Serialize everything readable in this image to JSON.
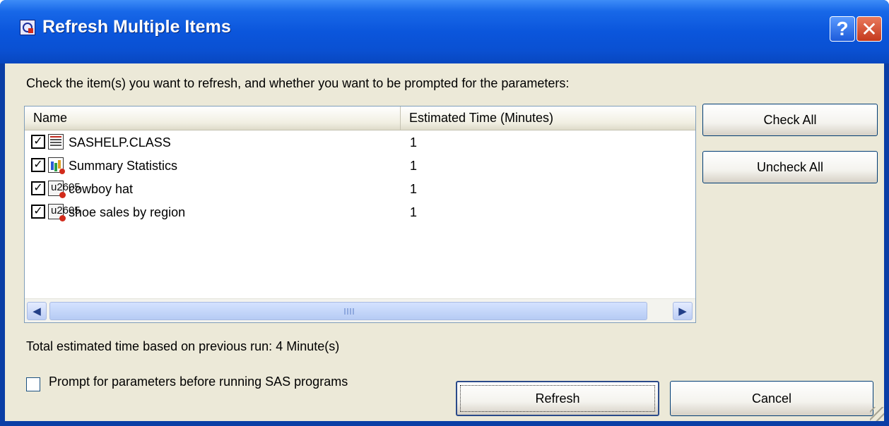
{
  "window": {
    "title": "Refresh Multiple Items",
    "help_label": "?",
    "close_label": "✕"
  },
  "instruction": "Check the item(s) you want to refresh, and whether you want to be prompted for the parameters:",
  "list": {
    "columns": [
      "Name",
      "Estimated Time (Minutes)"
    ],
    "items": [
      {
        "checked": true,
        "icon": "data-table-icon",
        "name": "SASHELP.CLASS",
        "time": "1"
      },
      {
        "checked": true,
        "icon": "statistics-task-icon",
        "name": "Summary Statistics",
        "time": "1"
      },
      {
        "checked": true,
        "icon": "sas-program-icon",
        "name": "cowboy hat",
        "time": "1"
      },
      {
        "checked": true,
        "icon": "sas-program-icon",
        "name": "shoe sales by region",
        "time": "1"
      }
    ],
    "check_glyph": "✓"
  },
  "buttons": {
    "check_all": "Check All",
    "uncheck_all": "Uncheck All",
    "refresh": "Refresh",
    "cancel": "Cancel"
  },
  "total_text": "Total estimated time based on previous run: 4 Minute(s)",
  "prompt": {
    "checked": false,
    "label": "Prompt for parameters before running SAS programs"
  },
  "scrollbar": {
    "left_arrow": "◀",
    "right_arrow": "▶"
  },
  "colors": {
    "titlebar": "#0b56dc",
    "dialog_bg": "#ece9d8",
    "close_red": "#c4391d"
  }
}
